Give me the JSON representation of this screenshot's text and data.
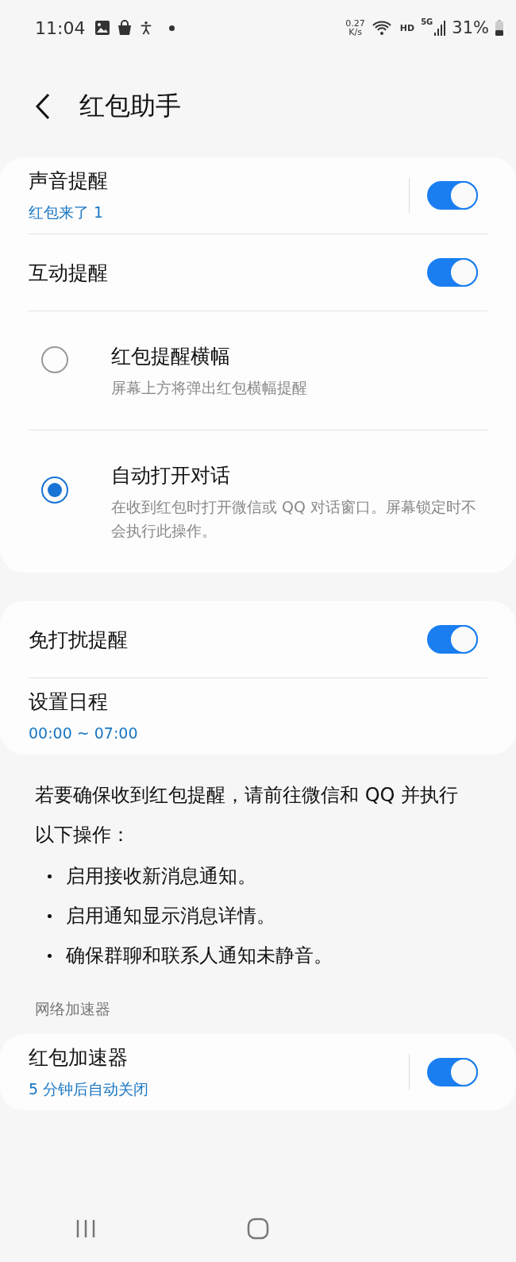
{
  "status_bar": {
    "time": "11:04",
    "speed_value": "0.27",
    "speed_unit": "K/s",
    "hd": "HD",
    "network": "5G",
    "battery": "31%"
  },
  "header": {
    "title": "红包助手"
  },
  "cards": [
    {
      "items": [
        {
          "kind": "split_switch",
          "title": "声音提醒",
          "subtitle": "红包来了 1",
          "on": true
        },
        {
          "kind": "switch",
          "title": "互动提醒",
          "on": true
        },
        {
          "kind": "radio",
          "title": "红包提醒横幅",
          "subtitle": "屏幕上方将弹出红包横幅提醒",
          "selected": false
        },
        {
          "kind": "radio",
          "title": "自动打开对话",
          "subtitle": "在收到红包时打开微信或 QQ 对话窗口。屏幕锁定时不会执行此操作。",
          "selected": true
        }
      ]
    },
    {
      "items": [
        {
          "kind": "switch",
          "title": "免打扰提醒",
          "on": true
        },
        {
          "kind": "link",
          "title": "设置日程",
          "subtitle": "00:00 ~ 07:00"
        }
      ]
    }
  ],
  "info": {
    "text": "若要确保收到红包提醒，请前往微信和 QQ 并执行以下操作：",
    "bullets": [
      "启用接收新消息通知。",
      "启用通知显示消息详情。",
      "确保群聊和联系人通知未静音。"
    ]
  },
  "section": {
    "title": "网络加速器",
    "items": [
      {
        "kind": "split_switch",
        "title": "红包加速器",
        "subtitle": "5 分钟后自动关闭",
        "on": true
      }
    ]
  }
}
